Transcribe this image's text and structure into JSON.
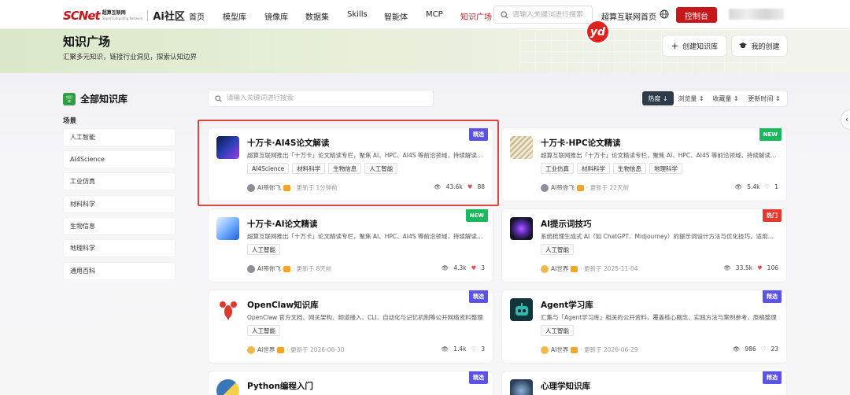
{
  "brand": {
    "logo_main": "SCNet",
    "logo_cn": "超算互联网",
    "logo_en": "SuperComputing Network",
    "section": "Ai社区",
    "accent": "#c6171d"
  },
  "nav": {
    "items": [
      "首页",
      "模型库",
      "镜像库",
      "数据集",
      "Skills",
      "智能体",
      "MCP",
      "知识广场"
    ],
    "active": "知识广场",
    "search_placeholder": "请输入关键词进行搜索",
    "home_link": "超算互联网首页",
    "console": "控制台"
  },
  "hero": {
    "title": "知识广场",
    "subtitle": "汇聚多元知识，链接行业洞见，探索认知边界",
    "create_btn": "创建知识库",
    "mine_btn": "我的创建",
    "float_badge": "yd"
  },
  "sidebar": {
    "title": "全部知识库",
    "icon_text_1": "知识",
    "icon_text_2": "库",
    "scene_label": "场景",
    "items": [
      "人工智能",
      "AI4Science",
      "工业仿真",
      "材料科学",
      "生物信息",
      "地理科学",
      "通用百科"
    ]
  },
  "toolbar": {
    "search_placeholder": "请输入关键词进行搜索",
    "sorts": [
      "热度 ↓",
      "浏览量 ↕",
      "收藏量 ↕",
      "更新时间 ↕"
    ],
    "active_sort": 0
  },
  "cards": [
    {
      "title": "十万卡·AI4S论文解读",
      "desc": "超算互联网推出「十万卡」论文精读专栏，聚焦 AI、HPC、AI4S 等前沿领域，持续解读最新研究成果与技术进展",
      "tags": [
        "AI4Science",
        "材料科学",
        "生物信息",
        "人工智能"
      ],
      "author": "AI带你飞",
      "updated": "· 更新于 1分钟前",
      "views": "43.6k",
      "likes": "88",
      "badge": "精选",
      "badge_type": "jx"
    },
    {
      "title": "十万卡·HPC论文精读",
      "desc": "超算互联网推出「十万卡」论文精读专栏，聚焦 AI、HPC、AI4S 等前沿领域，持续解读最新研究成果与技术进展",
      "tags": [
        "工业仿真",
        "材料科学",
        "生物信息",
        "地理科学"
      ],
      "author": "AI带你飞",
      "updated": "· 更新于 22天前",
      "views": "5.4k",
      "likes": "1",
      "badge": "NEW",
      "badge_type": "new"
    },
    {
      "title": "十万卡·AI论文精读",
      "desc": "超算互联网推出「十万卡」论文精读专栏，聚焦 AI、HPC、AI4S 等前沿领域，持续解读最新研究成果与技术进展",
      "tags": [
        "人工智能"
      ],
      "author": "AI带你飞",
      "updated": "· 更新于 8天前",
      "views": "4.3k",
      "likes": "3",
      "badge": "NEW",
      "badge_type": "new"
    },
    {
      "title": "AI提示词技巧",
      "desc": "系统梳理生成式 AI（如 ChatGPT、Midjourney）的提示词设计方法与优化技巧，适用于各类场景",
      "tags": [
        "人工智能"
      ],
      "author": "AI世界",
      "updated": "· 更新于 2025-11-04",
      "views": "33.5k",
      "likes": "106",
      "badge": "热门",
      "badge_type": "hot"
    },
    {
      "title": "OpenClaw知识库",
      "desc": "OpenClaw 官方文档、网关架构、频道接入、CLI、自动化与记忆机制等公开网络资料整理",
      "tags": [
        "人工智能"
      ],
      "author": "AI世界",
      "updated": "· 更新于 2026-06-30",
      "views": "1.4k",
      "likes": "3",
      "badge": "精选",
      "badge_type": "jx"
    },
    {
      "title": "Agent学习库",
      "desc": "汇集与「Agent学习库」相关的公开资料，覆盖核心概念、实践方法与案例参考，原稿整理",
      "tags": [
        "人工智能"
      ],
      "author": "AI世界",
      "updated": "· 更新于 2026-06-29",
      "views": "986",
      "likes": "23",
      "badge": "精选",
      "badge_type": "jx"
    },
    {
      "title": "Python编程入门",
      "desc": "",
      "tags": [],
      "author": "",
      "updated": "",
      "views": "",
      "likes": "",
      "badge": "精选",
      "badge_type": "jx"
    },
    {
      "title": "心理学知识库",
      "desc": "",
      "tags": [],
      "author": "",
      "updated": "",
      "views": "",
      "likes": "",
      "badge": "精选",
      "badge_type": "jx"
    }
  ]
}
